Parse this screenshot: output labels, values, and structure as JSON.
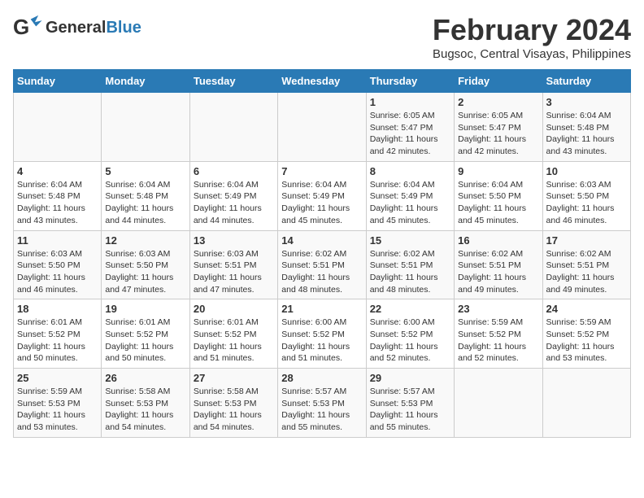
{
  "header": {
    "logo_general": "General",
    "logo_blue": "Blue",
    "month_year": "February 2024",
    "location": "Bugsoc, Central Visayas, Philippines"
  },
  "days_of_week": [
    "Sunday",
    "Monday",
    "Tuesday",
    "Wednesday",
    "Thursday",
    "Friday",
    "Saturday"
  ],
  "weeks": [
    [
      {
        "day": "",
        "info": ""
      },
      {
        "day": "",
        "info": ""
      },
      {
        "day": "",
        "info": ""
      },
      {
        "day": "",
        "info": ""
      },
      {
        "day": "1",
        "info": "Sunrise: 6:05 AM\nSunset: 5:47 PM\nDaylight: 11 hours\nand 42 minutes."
      },
      {
        "day": "2",
        "info": "Sunrise: 6:05 AM\nSunset: 5:47 PM\nDaylight: 11 hours\nand 42 minutes."
      },
      {
        "day": "3",
        "info": "Sunrise: 6:04 AM\nSunset: 5:48 PM\nDaylight: 11 hours\nand 43 minutes."
      }
    ],
    [
      {
        "day": "4",
        "info": "Sunrise: 6:04 AM\nSunset: 5:48 PM\nDaylight: 11 hours\nand 43 minutes."
      },
      {
        "day": "5",
        "info": "Sunrise: 6:04 AM\nSunset: 5:48 PM\nDaylight: 11 hours\nand 44 minutes."
      },
      {
        "day": "6",
        "info": "Sunrise: 6:04 AM\nSunset: 5:49 PM\nDaylight: 11 hours\nand 44 minutes."
      },
      {
        "day": "7",
        "info": "Sunrise: 6:04 AM\nSunset: 5:49 PM\nDaylight: 11 hours\nand 45 minutes."
      },
      {
        "day": "8",
        "info": "Sunrise: 6:04 AM\nSunset: 5:49 PM\nDaylight: 11 hours\nand 45 minutes."
      },
      {
        "day": "9",
        "info": "Sunrise: 6:04 AM\nSunset: 5:50 PM\nDaylight: 11 hours\nand 45 minutes."
      },
      {
        "day": "10",
        "info": "Sunrise: 6:03 AM\nSunset: 5:50 PM\nDaylight: 11 hours\nand 46 minutes."
      }
    ],
    [
      {
        "day": "11",
        "info": "Sunrise: 6:03 AM\nSunset: 5:50 PM\nDaylight: 11 hours\nand 46 minutes."
      },
      {
        "day": "12",
        "info": "Sunrise: 6:03 AM\nSunset: 5:50 PM\nDaylight: 11 hours\nand 47 minutes."
      },
      {
        "day": "13",
        "info": "Sunrise: 6:03 AM\nSunset: 5:51 PM\nDaylight: 11 hours\nand 47 minutes."
      },
      {
        "day": "14",
        "info": "Sunrise: 6:02 AM\nSunset: 5:51 PM\nDaylight: 11 hours\nand 48 minutes."
      },
      {
        "day": "15",
        "info": "Sunrise: 6:02 AM\nSunset: 5:51 PM\nDaylight: 11 hours\nand 48 minutes."
      },
      {
        "day": "16",
        "info": "Sunrise: 6:02 AM\nSunset: 5:51 PM\nDaylight: 11 hours\nand 49 minutes."
      },
      {
        "day": "17",
        "info": "Sunrise: 6:02 AM\nSunset: 5:51 PM\nDaylight: 11 hours\nand 49 minutes."
      }
    ],
    [
      {
        "day": "18",
        "info": "Sunrise: 6:01 AM\nSunset: 5:52 PM\nDaylight: 11 hours\nand 50 minutes."
      },
      {
        "day": "19",
        "info": "Sunrise: 6:01 AM\nSunset: 5:52 PM\nDaylight: 11 hours\nand 50 minutes."
      },
      {
        "day": "20",
        "info": "Sunrise: 6:01 AM\nSunset: 5:52 PM\nDaylight: 11 hours\nand 51 minutes."
      },
      {
        "day": "21",
        "info": "Sunrise: 6:00 AM\nSunset: 5:52 PM\nDaylight: 11 hours\nand 51 minutes."
      },
      {
        "day": "22",
        "info": "Sunrise: 6:00 AM\nSunset: 5:52 PM\nDaylight: 11 hours\nand 52 minutes."
      },
      {
        "day": "23",
        "info": "Sunrise: 5:59 AM\nSunset: 5:52 PM\nDaylight: 11 hours\nand 52 minutes."
      },
      {
        "day": "24",
        "info": "Sunrise: 5:59 AM\nSunset: 5:52 PM\nDaylight: 11 hours\nand 53 minutes."
      }
    ],
    [
      {
        "day": "25",
        "info": "Sunrise: 5:59 AM\nSunset: 5:53 PM\nDaylight: 11 hours\nand 53 minutes."
      },
      {
        "day": "26",
        "info": "Sunrise: 5:58 AM\nSunset: 5:53 PM\nDaylight: 11 hours\nand 54 minutes."
      },
      {
        "day": "27",
        "info": "Sunrise: 5:58 AM\nSunset: 5:53 PM\nDaylight: 11 hours\nand 54 minutes."
      },
      {
        "day": "28",
        "info": "Sunrise: 5:57 AM\nSunset: 5:53 PM\nDaylight: 11 hours\nand 55 minutes."
      },
      {
        "day": "29",
        "info": "Sunrise: 5:57 AM\nSunset: 5:53 PM\nDaylight: 11 hours\nand 55 minutes."
      },
      {
        "day": "",
        "info": ""
      },
      {
        "day": "",
        "info": ""
      }
    ]
  ]
}
